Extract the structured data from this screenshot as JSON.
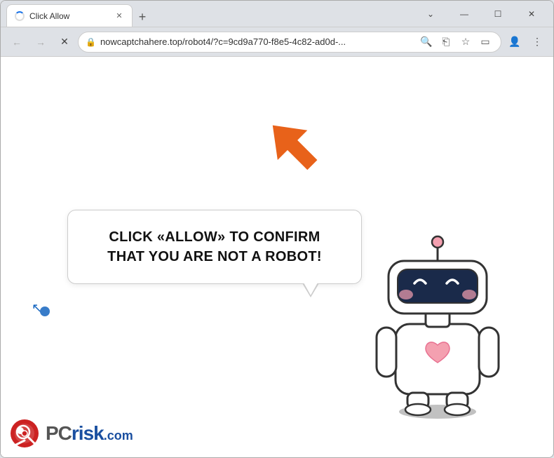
{
  "window": {
    "title": "Click Allow",
    "tab_title": "Click Allow",
    "controls": {
      "minimize": "—",
      "maximize": "☐",
      "close": "✕",
      "chevron_down": "⌄"
    }
  },
  "nav": {
    "back_label": "←",
    "forward_label": "→",
    "reload_label": "✕",
    "url": "nowcaptchahere.top/robot4/?c=9cd9a770-f8e5-4c82-ad0d-...",
    "search_icon": "🔍",
    "share_icon": "⎋",
    "star_icon": "☆",
    "sidebar_icon": "▭",
    "profile_icon": "👤",
    "menu_icon": "⋮"
  },
  "page": {
    "bubble_text": "CLICK «ALLOW» TO CONFIRM THAT YOU ARE NOT A ROBOT!",
    "arrow_direction": "upper-right"
  },
  "pcrisk": {
    "domain": ".com",
    "brand_pc": "PC",
    "brand_risk": "risk"
  }
}
